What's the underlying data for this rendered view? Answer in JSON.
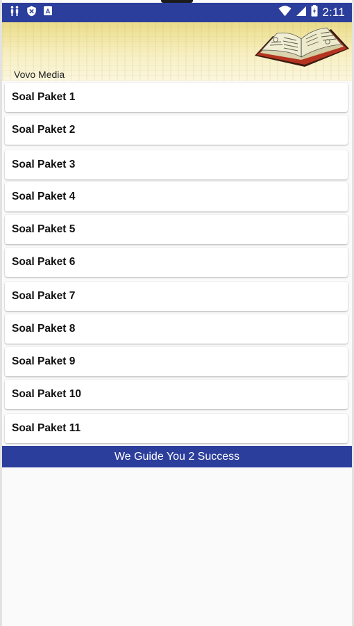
{
  "status_bar": {
    "time": "2:11",
    "left_icons": [
      "accessibility-icon",
      "shield-icon",
      "store-icon"
    ],
    "right_icons": [
      "wifi-icon",
      "signal-icon",
      "battery-icon"
    ]
  },
  "header": {
    "title": "Vovo Media",
    "image": "open-book-icon"
  },
  "list": {
    "items": [
      {
        "label": "Soal Paket 1"
      },
      {
        "label": "Soal Paket 2"
      },
      {
        "label": "Soal Paket 3"
      },
      {
        "label": "Soal Paket 4"
      },
      {
        "label": "Soal Paket 5"
      },
      {
        "label": "Soal Paket 6"
      },
      {
        "label": "Soal Paket 7"
      },
      {
        "label": "Soal Paket 8"
      },
      {
        "label": "Soal Paket 9"
      },
      {
        "label": "Soal Paket 10"
      },
      {
        "label": "Soal Paket 11"
      }
    ]
  },
  "banner": {
    "text": "We Guide You 2 Success"
  },
  "colors": {
    "primary": "#2c3e9b",
    "header_gold": "#efe39c",
    "background": "#fafafa",
    "card": "#ffffff"
  }
}
